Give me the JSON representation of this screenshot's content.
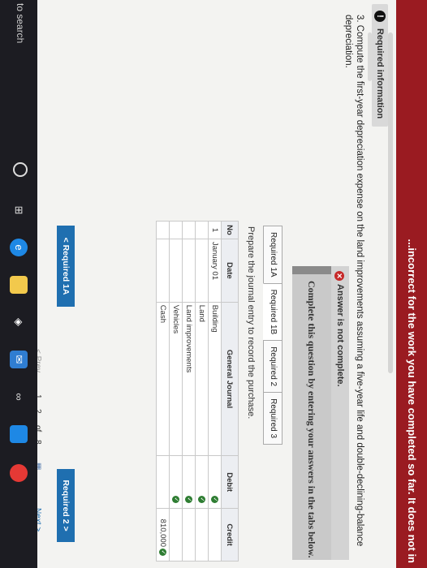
{
  "banner": {
    "text": "...incorrect for the work you have completed so far. It does not in"
  },
  "required_info": {
    "label": "Required information",
    "icon": "info-icon"
  },
  "question": {
    "text": "3. Compute the first-year depreciation expense on the land improvements assuming a five-year life and double-declining-balance depreciation."
  },
  "status": {
    "icon": "error-x-icon",
    "text": "Answer is not complete."
  },
  "instruction": {
    "text": "Complete this question by entering your answers in the tabs below."
  },
  "tabs": [
    {
      "label": "Required 1A"
    },
    {
      "label": "Required 1B"
    },
    {
      "label": "Required 2"
    },
    {
      "label": "Required 3"
    }
  ],
  "prompt": {
    "text": "Prepare the journal entry to record the purchase."
  },
  "journal": {
    "headers": {
      "no": "No",
      "date": "Date",
      "account": "General Journal",
      "debit": "Debit",
      "credit": "Credit"
    },
    "rows": [
      {
        "no": "1",
        "date": "January 01",
        "account": "Building",
        "debit": "",
        "credit": ""
      },
      {
        "no": "",
        "date": "",
        "account": "Land",
        "debit": "",
        "credit": ""
      },
      {
        "no": "",
        "date": "",
        "account": "Land improvements",
        "debit": "",
        "credit": ""
      },
      {
        "no": "",
        "date": "",
        "account": "Vehicles",
        "debit": "",
        "credit": ""
      },
      {
        "no": "",
        "date": "",
        "account": "Cash",
        "debit": "",
        "credit": "810,000"
      }
    ]
  },
  "nav": {
    "prev_label": "< Required 1A",
    "next_label": "Required 2  >"
  },
  "pager": {
    "prev": "< Prev",
    "page1": "1",
    "page2": "2",
    "of": "of",
    "total": "8",
    "next": "Next >"
  },
  "taskbar": {
    "search": "to search"
  },
  "colors": {
    "banner": "#9a1b21",
    "button": "#1f6fb0",
    "check": "#2e7d32",
    "error": "#c62828"
  }
}
